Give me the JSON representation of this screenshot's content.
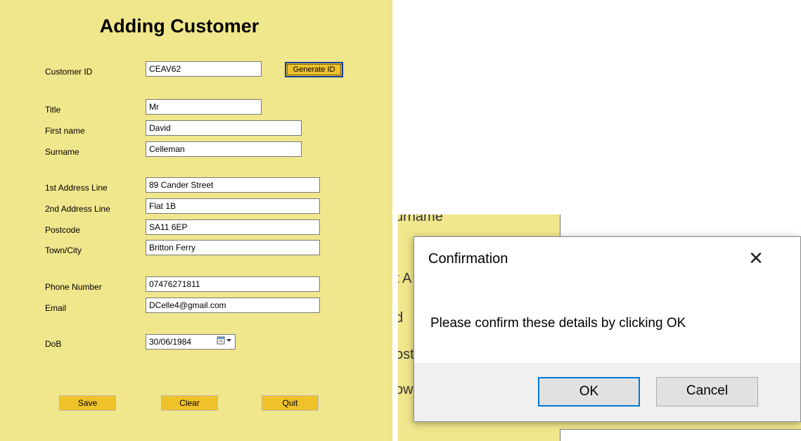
{
  "form": {
    "title": "Adding Customer",
    "customer_id": {
      "label": "Customer ID",
      "value": "CEAV62"
    },
    "generate_label": "Generate ID",
    "title_field": {
      "label": "Title",
      "value": "Mr"
    },
    "first_name": {
      "label": "First name",
      "value": "David"
    },
    "surname": {
      "label": "Surname",
      "value": "Celleman"
    },
    "address1": {
      "label": "1st Address Line",
      "value": "89 Cander Street"
    },
    "address2": {
      "label": "2nd Address Line",
      "value": "Flat 1B"
    },
    "postcode": {
      "label": "Postcode",
      "value": "SA11 6EP"
    },
    "town": {
      "label": "Town/City",
      "value": "Britton Ferry"
    },
    "phone": {
      "label": "Phone Number",
      "value": "07476271811"
    },
    "email": {
      "label": "Email",
      "value": "DCelle4@gmail.com"
    },
    "dob": {
      "label": "DoB",
      "value": "30/06/1984"
    },
    "buttons": {
      "save": "Save",
      "clear": "Clear",
      "quit": "Quit"
    }
  },
  "background_fragments": {
    "surname_partial": "urname",
    "address1_partial": "t A",
    "address2_partial": "d",
    "postcode_partial": "ost",
    "town_partial": "owr"
  },
  "dialog": {
    "title": "Confirmation",
    "close_glyph": "✕",
    "message": "Please confirm these details by clicking OK",
    "ok_label": "OK",
    "cancel_label": "Cancel"
  },
  "icons": {
    "calendar": "calendar-icon",
    "dropdown": "chevron-down-icon",
    "close": "close-icon"
  },
  "colors": {
    "form_bg": "#f0e68c",
    "button_bg": "#f0c22a",
    "focus": "#0078d7"
  }
}
